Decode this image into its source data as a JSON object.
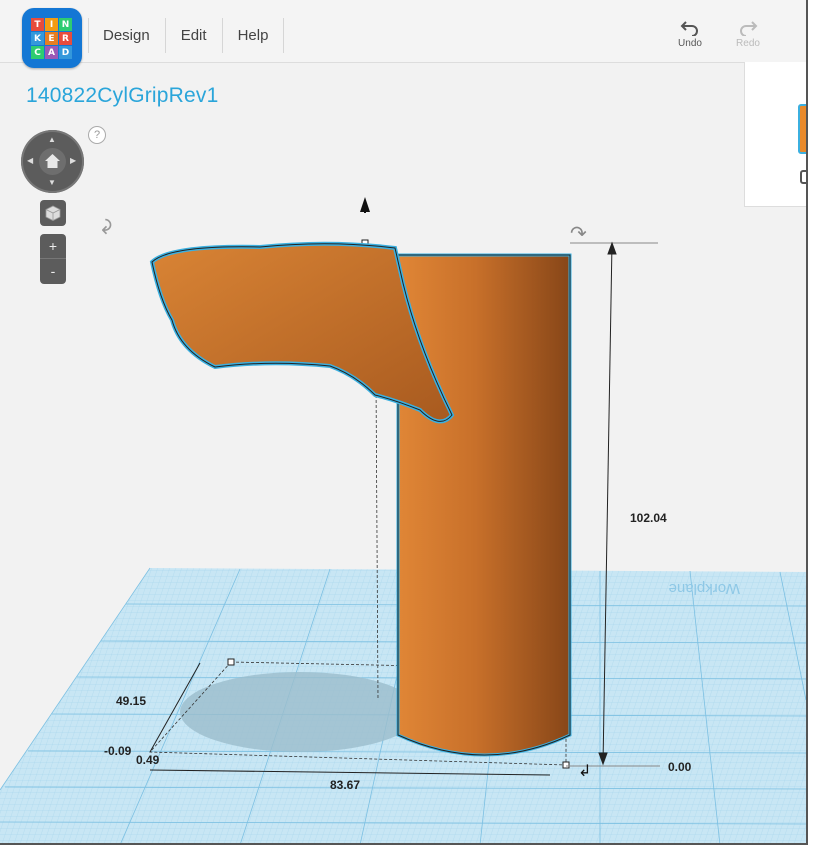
{
  "app": {
    "logo_letters": [
      "T",
      "I",
      "N",
      "K",
      "E",
      "R",
      "C",
      "A",
      "D"
    ]
  },
  "menu": {
    "items": [
      {
        "label": "Design"
      },
      {
        "label": "Edit"
      },
      {
        "label": "Help"
      }
    ]
  },
  "toolbar": {
    "undo_label": "Undo",
    "redo_label": "Redo"
  },
  "project": {
    "title": "140822CylGripRev1"
  },
  "view_controls": {
    "help_label": "?",
    "zoom_in_label": "+",
    "zoom_out_label": "-"
  },
  "workplane": {
    "label": "Workplane"
  },
  "dimensions": {
    "height": "102.04",
    "width": "83.67",
    "depth": "49.15",
    "offset_x": "-0.09",
    "offset_y": "0.49",
    "elevation": "0.00"
  },
  "colors": {
    "shape": "#c46a22",
    "selection_outline": "#3bb0e0",
    "workplane": "#bfe2f2",
    "accent": "#2aa5da"
  }
}
